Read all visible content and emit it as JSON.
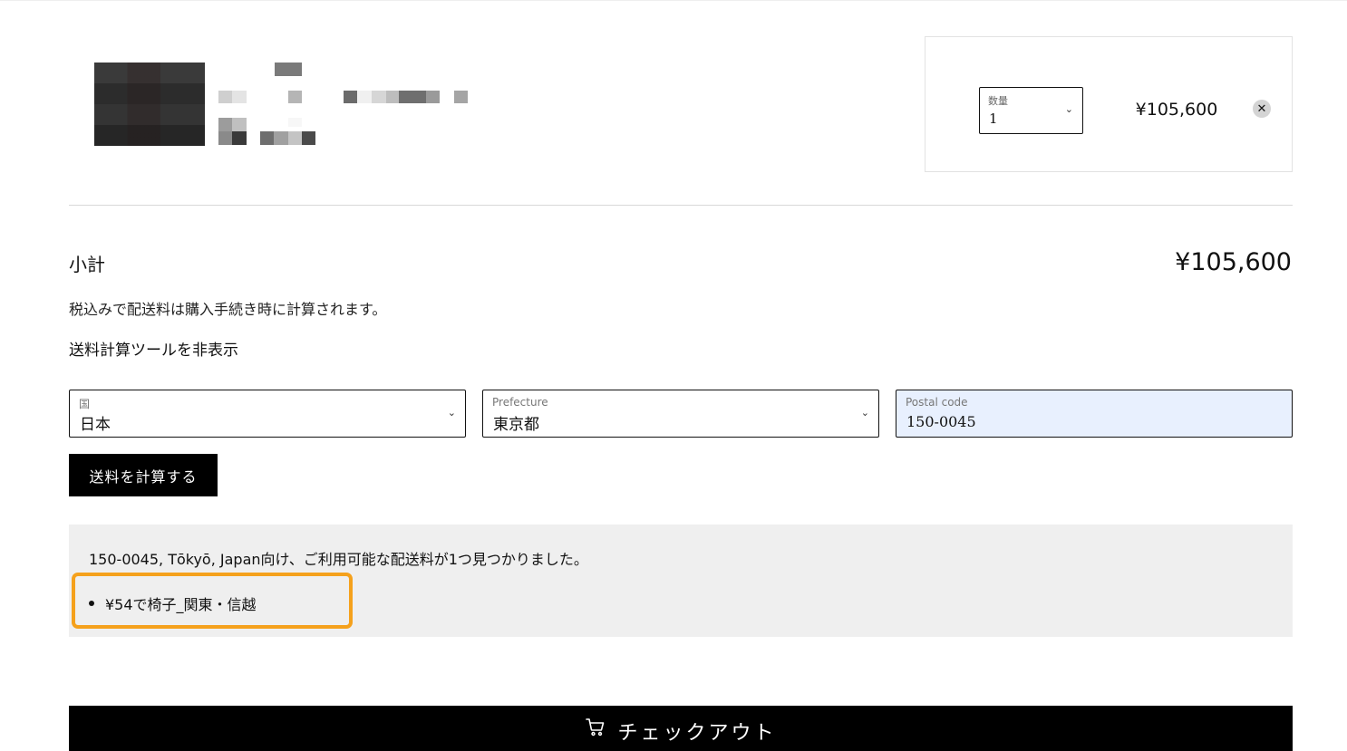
{
  "cart_item": {
    "quantity_label": "数量",
    "quantity_value": "1",
    "line_price": "¥105,600"
  },
  "summary": {
    "subtotal_label": "小計",
    "subtotal_value": "¥105,600",
    "tax_note": "税込みで配送料は購入手続き時に計算されます。",
    "toggle_calculator_label": "送料計算ツールを非表示"
  },
  "shipping_calculator": {
    "country_label": "国",
    "country_value": "日本",
    "prefecture_label": "Prefecture",
    "prefecture_value": "東京都",
    "postal_label": "Postal code",
    "postal_value": "150-0045",
    "calculate_button": "送料を計算する"
  },
  "shipping_rates": {
    "message": "150-0045, Tōkyō, Japan向け、ご利用可能な配送料が1つ見つかりました。",
    "rates": [
      "¥54で椅子_関東・信越"
    ],
    "highlight_color": "#f5a11c"
  },
  "checkout": {
    "button_label": "チェックアウト",
    "icon": "cart-icon"
  }
}
